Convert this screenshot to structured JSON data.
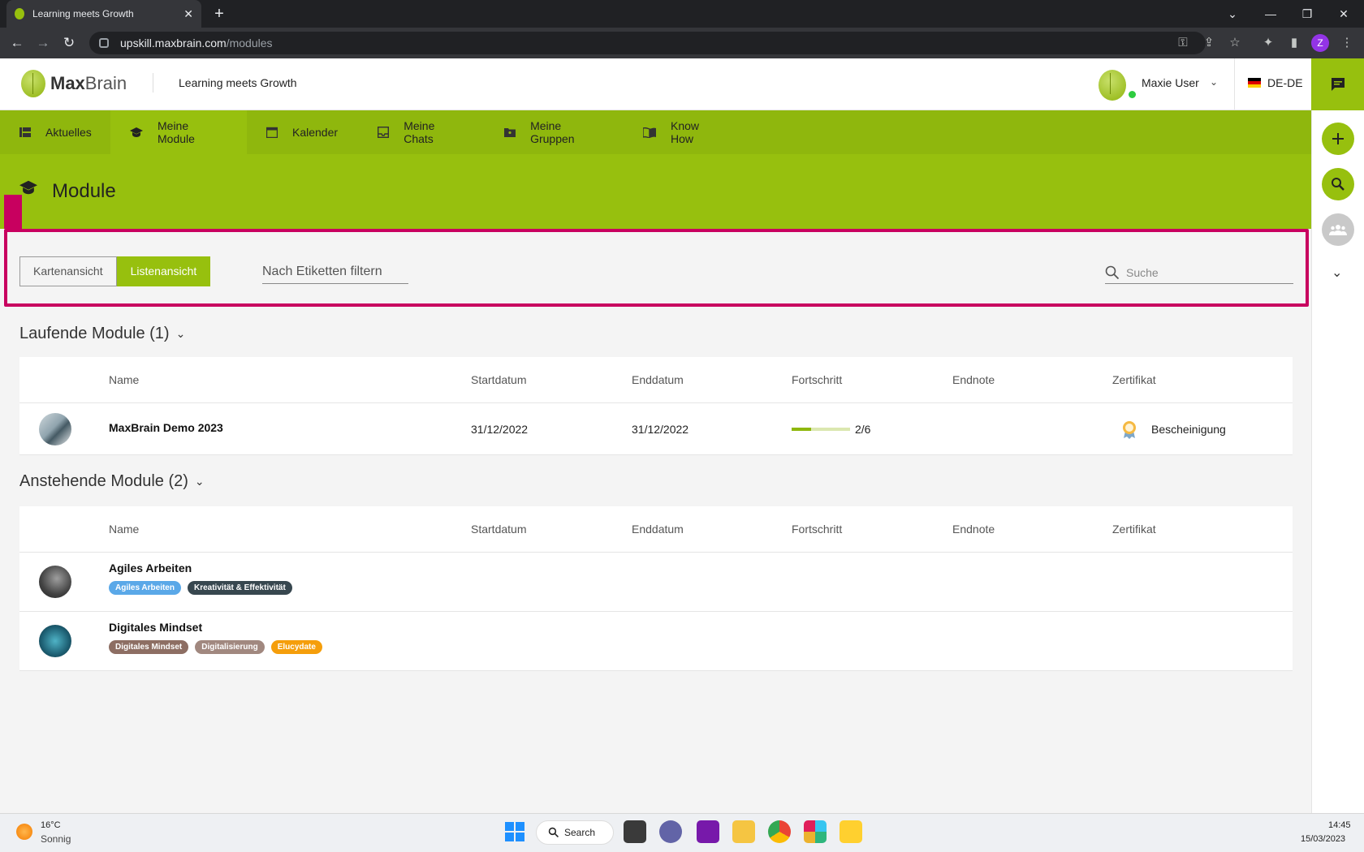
{
  "browser": {
    "tab_title": "Learning meets Growth",
    "url_host": "upskill.maxbrain.com",
    "url_path": "/modules",
    "profile_initial": "Z"
  },
  "header": {
    "brand_bold": "Max",
    "brand_light": "Brain",
    "tagline": "Learning meets Growth",
    "user_name": "Maxie User",
    "language": "DE-DE"
  },
  "nav": [
    {
      "label": "Aktuelles"
    },
    {
      "label": "Meine Module"
    },
    {
      "label": "Kalender"
    },
    {
      "label": "Meine Chats"
    },
    {
      "label": "Meine Gruppen"
    },
    {
      "label": "Know How"
    }
  ],
  "page": {
    "title": "Module",
    "view_card": "Kartenansicht",
    "view_list": "Listenansicht",
    "tag_filter_placeholder": "Nach Etiketten filtern",
    "search_placeholder": "Suche"
  },
  "columns": {
    "name": "Name",
    "start": "Startdatum",
    "end": "Enddatum",
    "progress": "Fortschritt",
    "grade": "Endnote",
    "certificate": "Zertifikat"
  },
  "running": {
    "heading": "Laufende Module (1)",
    "rows": [
      {
        "name": "MaxBrain Demo 2023",
        "start": "31/12/2022",
        "end": "31/12/2022",
        "progress_text": "2/6",
        "progress_fraction": 0.333,
        "certificate": "Bescheinigung"
      }
    ]
  },
  "upcoming": {
    "heading": "Anstehende Module (2)",
    "rows": [
      {
        "name": "Agiles Arbeiten",
        "tags": [
          {
            "label": "Agiles Arbeiten",
            "color": "#5aa8e8"
          },
          {
            "label": "Kreativität & Effektivität",
            "color": "#37474f"
          }
        ]
      },
      {
        "name": "Digitales Mindset",
        "tags": [
          {
            "label": "Digitales Mindset",
            "color": "#8d6e63"
          },
          {
            "label": "Digitalisierung",
            "color": "#a1887f"
          },
          {
            "label": "Elucydate",
            "color": "#f59e0b"
          }
        ]
      }
    ]
  },
  "colors": {
    "brand_green": "#97c00e",
    "highlight": "#c8005f"
  },
  "taskbar": {
    "temp": "16°C",
    "weather": "Sonnig",
    "search": "Search",
    "time": "14:45",
    "date": "15/03/2023"
  }
}
